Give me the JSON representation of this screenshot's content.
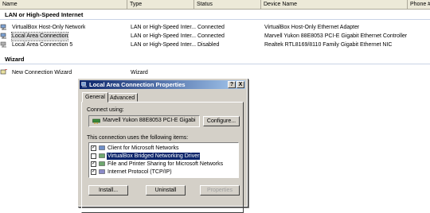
{
  "columns": [
    "Name",
    "Type",
    "Status",
    "Device Name",
    "Phone #"
  ],
  "groups": [
    {
      "title": "LAN or High-Speed Internet",
      "rows": [
        {
          "name": "VirtualBox Host-Only Network",
          "type": "LAN or High-Speed Inter...",
          "status": "Connected",
          "device": "VirtualBox Host-Only Ethernet Adapter",
          "selected": false
        },
        {
          "name": "Local Area Connection",
          "type": "LAN or High-Speed Inter...",
          "status": "Connected",
          "device": "Marvell Yukon 88E8053 PCI-E Gigabit Ethernet Controller",
          "selected": true
        },
        {
          "name": "Local Area Connection 5",
          "type": "LAN or High-Speed Inter...",
          "status": "Disabled",
          "device": "Realtek RTL8169/8110 Family Gigabit Ethernet NIC",
          "selected": false
        }
      ]
    },
    {
      "title": "Wizard",
      "rows": [
        {
          "name": "New Connection Wizard",
          "type": "Wizard",
          "status": "",
          "device": "",
          "selected": false
        }
      ]
    }
  ],
  "dialog": {
    "title": "Local Area Connection Properties",
    "help_glyph": "?",
    "close_glyph": "X",
    "tabs": [
      "General",
      "Advanced"
    ],
    "active_tab": "General",
    "connect_using_label": "Connect using:",
    "adapter": "Marvell Yukon 88E8053 PCI-E Gigabi",
    "configure_label": "Configure...",
    "items_label": "This connection uses the following items:",
    "items": [
      {
        "label": "Client for Microsoft Networks",
        "checked": true,
        "highlighted": false
      },
      {
        "label": "VirtualBox Bridged Networking Driver",
        "checked": false,
        "highlighted": true
      },
      {
        "label": "File and Printer Sharing for Microsoft Networks",
        "checked": true,
        "highlighted": false
      },
      {
        "label": "Internet Protocol (TCP/IP)",
        "checked": true,
        "highlighted": false
      }
    ],
    "install_label": "Install...",
    "uninstall_label": "Uninstall",
    "properties_label": "Properties"
  },
  "colors": {
    "titlebar": "#0a246a",
    "highlight": "#0a246a",
    "face": "#d4d0c8"
  }
}
